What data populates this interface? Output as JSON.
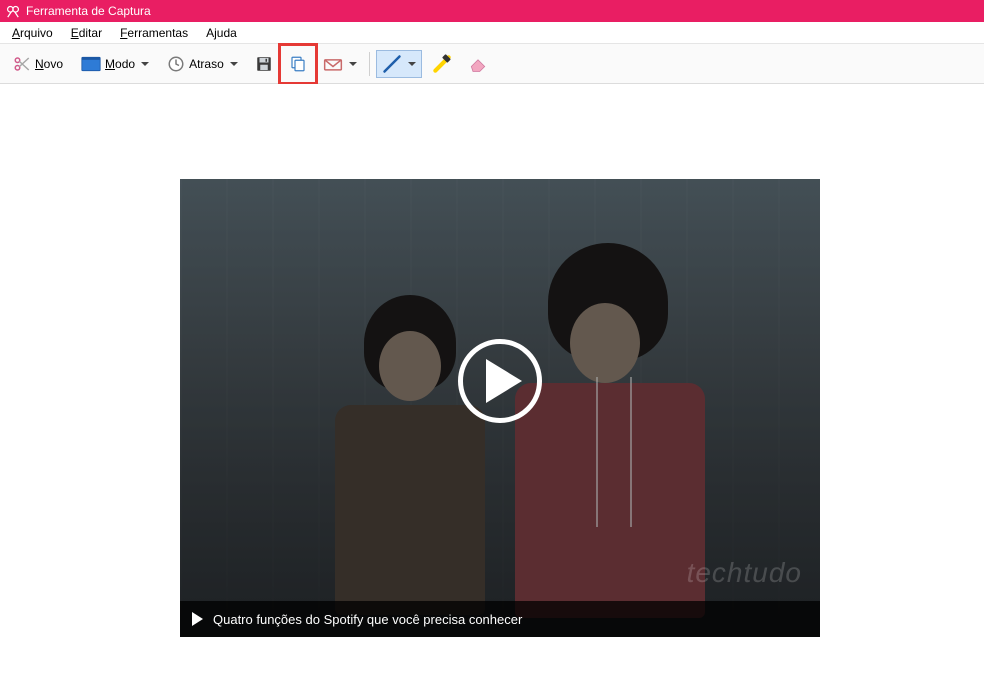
{
  "window": {
    "title": "Ferramenta de Captura",
    "accent_color": "#e91e63"
  },
  "menu": {
    "file": "Arquivo",
    "edit": "Editar",
    "tools": "Ferramentas",
    "help": "Ajuda"
  },
  "toolbar": {
    "new_label": "Novo",
    "mode_label": "Modo",
    "delay_label": "Atraso",
    "icons": {
      "new": "scissors-icon",
      "mode": "rectangle-icon",
      "delay": "clock-icon",
      "save": "save-icon",
      "copy": "copy-icon",
      "send": "mail-icon",
      "pen": "pen-icon",
      "highlighter": "highlighter-icon",
      "eraser": "eraser-icon"
    },
    "highlighted_button": "copy",
    "highlight_color": "#e53935",
    "pen_selected": true,
    "pen_color": "#1e5fab",
    "highlighter_color": "#ffd400"
  },
  "capture": {
    "video_caption": "Quatro funções do Spotify que você precisa conhecer",
    "watermark": "techtudo",
    "has_play_overlay": true
  }
}
